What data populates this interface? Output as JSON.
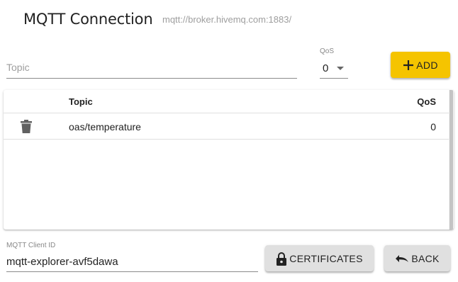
{
  "header": {
    "title": "MQTT Connection",
    "broker_url": "mqtt://broker.hivemq.com:1883/"
  },
  "add_form": {
    "topic_placeholder": "Topic",
    "topic_value": "",
    "qos_label": "QoS",
    "qos_value": "0",
    "add_label": "ADD",
    "add_icon": "plus-icon",
    "accent_color": "#f5c400"
  },
  "table": {
    "columns": {
      "topic": "Topic",
      "qos": "QoS"
    },
    "rows": [
      {
        "topic": "oas/temperature",
        "qos": "0",
        "delete_icon": "trash-icon"
      }
    ]
  },
  "footer": {
    "client_id_label": "MQTT Client ID",
    "client_id_value": "mqtt-explorer-avf5dawa",
    "certificates_label": "CERTIFICATES",
    "certificates_icon": "lock-icon",
    "back_label": "BACK",
    "back_icon": "undo-icon"
  }
}
